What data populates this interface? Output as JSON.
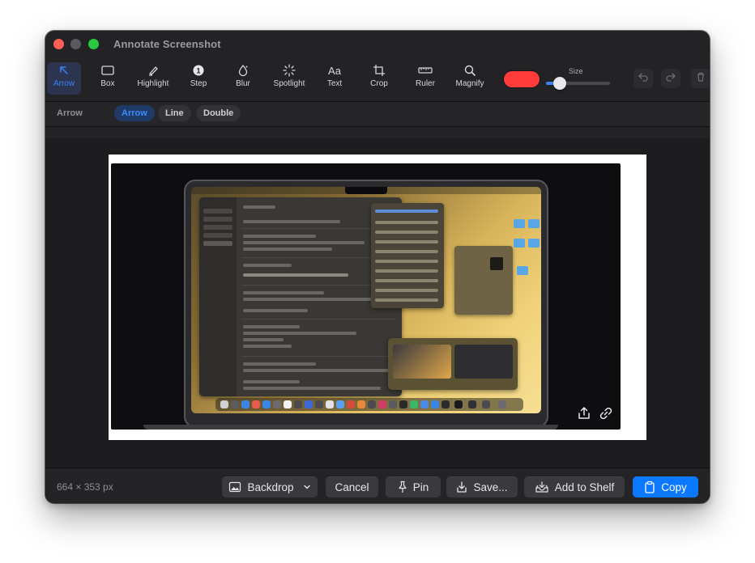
{
  "window": {
    "title": "Annotate Screenshot"
  },
  "toolbar": {
    "tools": [
      {
        "label": "Arrow",
        "icon": "arrow-icon",
        "active": true
      },
      {
        "label": "Box",
        "icon": "box-icon"
      },
      {
        "label": "Highlight",
        "icon": "highlight-pen-icon"
      },
      {
        "label": "Step",
        "icon": "step-number-icon",
        "glyph": "1"
      },
      {
        "label": "Blur",
        "icon": "blur-drop-icon"
      },
      {
        "label": "Spotlight",
        "icon": "spotlight-icon"
      },
      {
        "label": "Text",
        "icon": "text-icon",
        "glyph": "Aa"
      },
      {
        "label": "Crop",
        "icon": "crop-icon"
      },
      {
        "label": "Ruler",
        "icon": "ruler-icon"
      },
      {
        "label": "Magnify",
        "icon": "magnify-icon"
      }
    ],
    "color": "#ff3b3b",
    "size_label": "Size",
    "size_value": 0.2,
    "undo_icon": "undo-icon",
    "redo_icon": "redo-icon",
    "delete_icon": "trash-icon"
  },
  "subbar": {
    "label": "Arrow",
    "options": [
      "Arrow",
      "Line",
      "Double"
    ],
    "selected": "Arrow"
  },
  "footer": {
    "dimensions": "664 × 353 px",
    "backdrop_label": "Backdrop",
    "cancel_label": "Cancel",
    "pin_label": "Pin",
    "save_label": "Save...",
    "shelf_label": "Add to Shelf",
    "copy_label": "Copy"
  },
  "colors": {
    "accent": "#0a78ff",
    "window_bg": "#232326",
    "annotation_color": "#ff3b3b"
  }
}
